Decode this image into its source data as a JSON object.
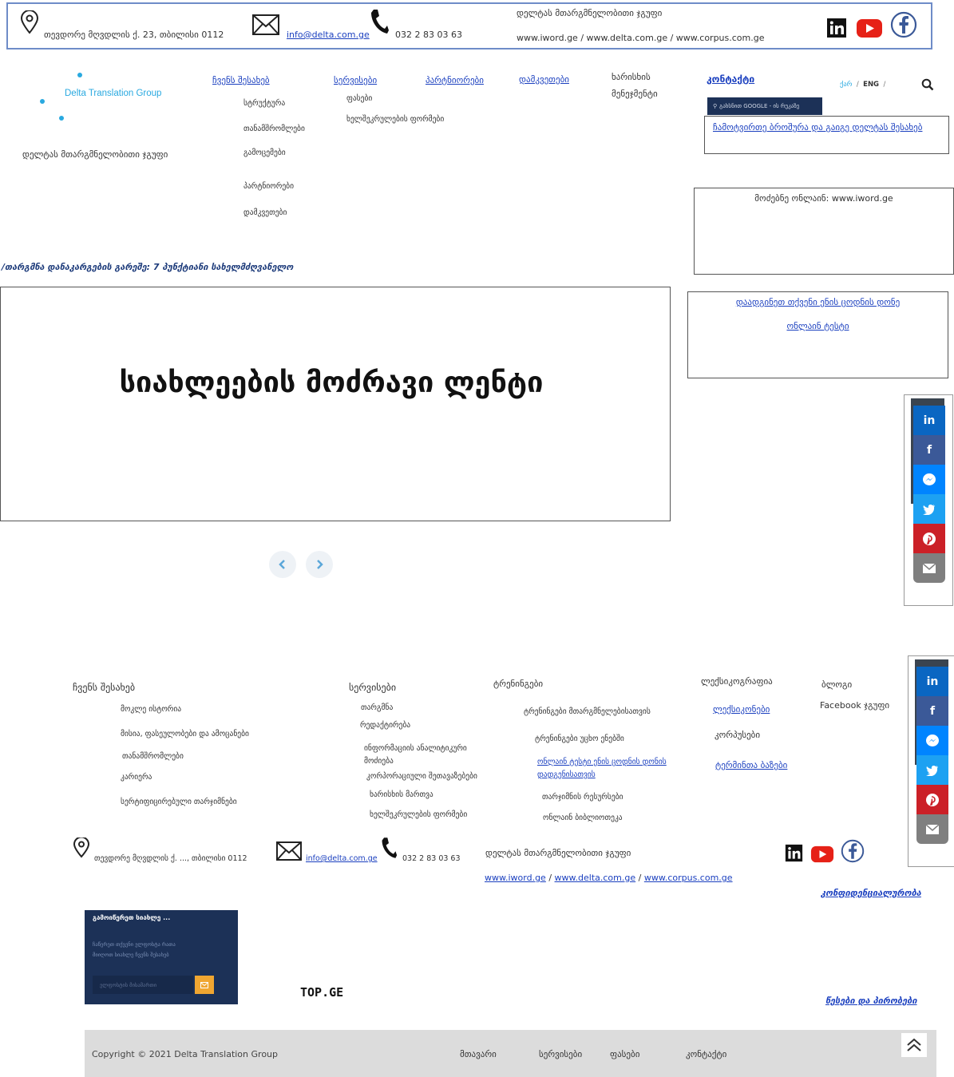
{
  "topbar": {
    "address": "თევდორე მღვდლის ქ. 23, თბილისი 0112",
    "email": "info@delta.com.ge",
    "phone": "032 2 83 03 63",
    "group_name": "დელტას მთარგმნელობითი ჯგუფი",
    "websites": "www.iword.ge / www.delta.com.ge / www.corpus.com.ge"
  },
  "logo": {
    "text": "Delta Translation Group",
    "tagline": "დელტას მთარგმნელობითი ჯგუფი"
  },
  "nav": {
    "about": "ჩვენს შესახებ",
    "about_sub": [
      "სტრუქტურა",
      "თანამშრომლები",
      "გამოცემები",
      "პარტნიორები",
      "დამკვეთები"
    ],
    "services": "სერვისები",
    "services_sub": [
      "ფასები",
      "ხელშეკრულების ფორმები"
    ],
    "partners": "პარტნიორები",
    "clients": "დამკვეთები",
    "quality_1": "ხარისხის",
    "quality_2": "მენეჯმენტი",
    "contact": "კონტაქტი",
    "lang_ka": "ქარ",
    "lang_sep1": "/",
    "lang_en": "ENG",
    "lang_sep2": "/"
  },
  "contact_panel": {
    "maps_btn": "გახსნით GOOGLE - ის რუკაზე",
    "brochure_link": "ჩამოტვირთე ბროშურა და გაიგე დელტას შესახებ"
  },
  "search_box": {
    "text": "მოძებნე ონლაინ: www.iword.ge"
  },
  "test_box": {
    "line1": "დაადგინეთ თქვენი ენის ცოდნის დონე",
    "line2": "ონლაინ ტესტი"
  },
  "breadcrumb": "/თარგმნა დანაკარგების გარეშე: 7 პუნქტიანი სახელმძღვანელო",
  "slider": {
    "title": "სიახლეების მოძრავი ლენტი"
  },
  "share": {
    "in": "in",
    "fb": "f"
  },
  "footer": {
    "col1": {
      "title": "ჩვენს შესახებ",
      "items": [
        "მოკლე ისტორია",
        "მისია, ფასეულობები და ამოცანები",
        "თანამშრომლები",
        "კარიერა",
        "სერტიფიცირებული თარჯიმნები"
      ]
    },
    "col2": {
      "title": "სერვისები",
      "items": [
        "თარგმნა",
        "რედაქტირება",
        "ინფორმაციის ანალიტიკური",
        "მოძიება",
        "კორპორაციული შეთავაზებები",
        "ხარისხის მართვა",
        "ხელშეკრულების ფორმები"
      ]
    },
    "col3": {
      "title": "ტრენინგები",
      "items": [
        "ტრენინგები მთარგმნელებისათვის",
        "ტრენინგები უცხო ენებში"
      ],
      "link_1": "ონლაინ ტესტი ენის ცოდნის დონის",
      "link_2": "დადგენისათვის",
      "items2": [
        "თარჯიმნის რესურსები",
        "ონლაინ ბიბლიოთეკა"
      ]
    },
    "col4": {
      "title": "ლექსიკოგრაფია",
      "link1": "ლექსიკონები",
      "item": "კორპუსები",
      "link2": "ტერმინთა ბაზები"
    },
    "col5": {
      "title": "ბლოგი",
      "item": "Facebook ჯგუფი"
    },
    "address": "თევდორე მღვდლის ქ. ..., თბილისი 0112",
    "email": "info@delta.com.ge",
    "phone": "032 2 83 03 63",
    "group_name": "დელტას მთარგმნელობითი ჯგუფი",
    "site1": "www.iword.ge",
    "site_sep1": "/",
    "site2": "www.delta.com.ge",
    "site_sep2": "/",
    "site3": "www.corpus.com.ge",
    "privacy": "კონფიდენციალურობა",
    "terms": "წესები და პირობები",
    "newsletter": {
      "title": "გამოიწერეთ სიახლე ...",
      "desc_1": "ჩაწერეთ თქვენი ელფოსტა რათა",
      "desc_2": "მიიღოთ სიახლე ჩვენს შესახებ",
      "placeholder": "ელფოსტის მისამართი"
    },
    "top_ge": "TOP.GE",
    "copyright": "Copyright © 2021 Delta Translation Group",
    "links": [
      "მთავარი",
      "სერვისები",
      "ფასები",
      "კონტაქტი"
    ]
  },
  "colors": {
    "linkedin": "#0a66c2",
    "facebook": "#3b5998",
    "messenger": "#0084ff",
    "twitter": "#1da1f2",
    "pinterest": "#cb2027",
    "email": "#7f7f7f",
    "youtube": "#e62117",
    "newsletter_bg": "#1c3157",
    "accent": "#29a9e0"
  }
}
